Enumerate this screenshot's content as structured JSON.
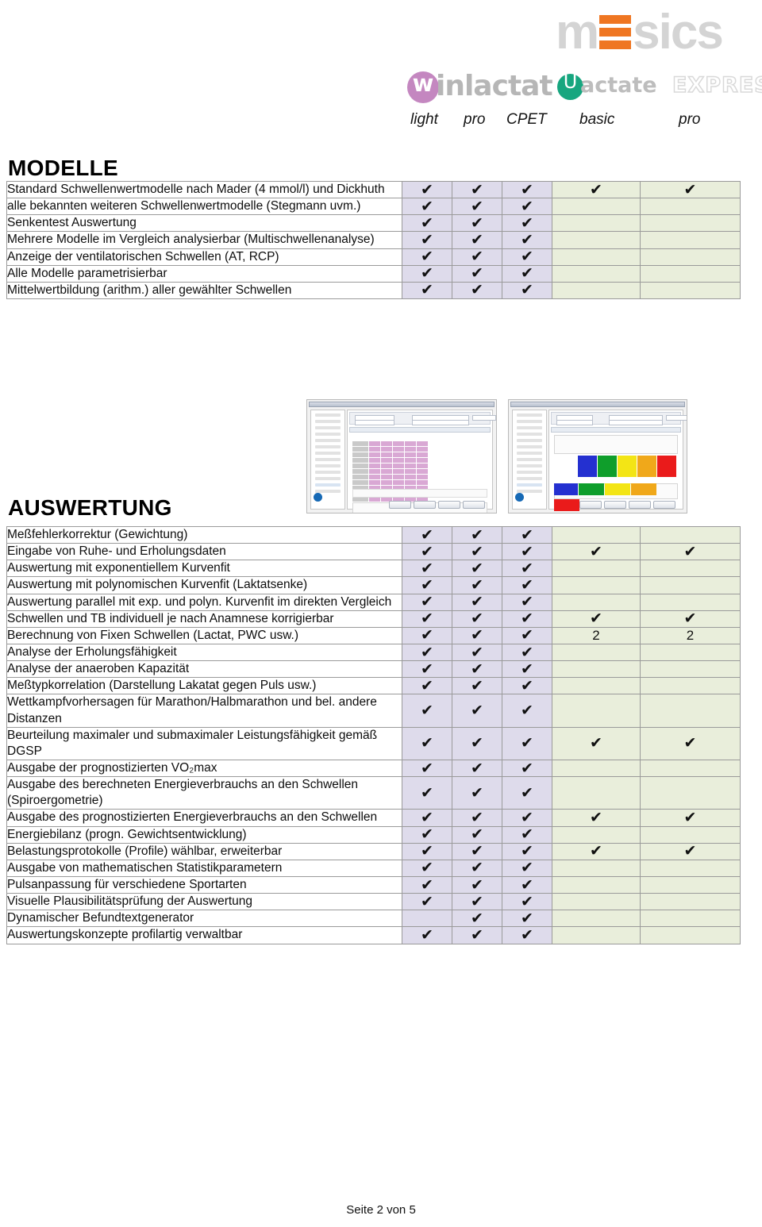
{
  "header": {
    "brand": "mesics",
    "product_winlactat": "inlactat",
    "product_winlactat_mark": "w",
    "product_lactate": "actate",
    "product_lactate_express": "EXPRESS",
    "product_lactate_mark": "U",
    "editions": [
      "light",
      "pro",
      "CPET",
      "basic",
      "pro"
    ]
  },
  "colors": {
    "brand_orange": "#ef7622",
    "brand_grey": "#d4d4d4",
    "winlactat_purple": "#c487c0",
    "lactate_green": "#17a67f",
    "col_group_a_bg": "#dedbeb",
    "col_group_b_bg": "#e9eedb"
  },
  "sections": [
    {
      "title": "MODELLE",
      "rows": [
        {
          "label": "Standard Schwellenwertmodelle nach Mader (4 mmol/l) und Dickhuth",
          "cells": [
            "✔",
            "✔",
            "✔",
            "✔",
            "✔"
          ]
        },
        {
          "label": "alle bekannten weiteren Schwellenwertmodelle (Stegmann uvm.)",
          "cells": [
            "✔",
            "✔",
            "✔",
            "",
            ""
          ]
        },
        {
          "label": "Senkentest Auswertung",
          "cells": [
            "✔",
            "✔",
            "✔",
            "",
            ""
          ]
        },
        {
          "label": "Mehrere Modelle im Vergleich analysierbar (Multischwellenanalyse)",
          "cells": [
            "✔",
            "✔",
            "✔",
            "",
            ""
          ]
        },
        {
          "label": "Anzeige der ventilatorischen Schwellen (AT, RCP)",
          "cells": [
            "✔",
            "✔",
            "✔",
            "",
            ""
          ]
        },
        {
          "label": "Alle Modelle parametrisierbar",
          "cells": [
            "✔",
            "✔",
            "✔",
            "",
            ""
          ]
        },
        {
          "label": "Mittelwertbildung (arithm.) aller gewählter Schwellen",
          "cells": [
            "✔",
            "✔",
            "✔",
            "",
            ""
          ]
        }
      ]
    },
    {
      "title": "AUSWERTUNG",
      "rows": [
        {
          "label": "Meßfehlerkorrektur (Gewichtung)",
          "cells": [
            "✔",
            "✔",
            "✔",
            "",
            ""
          ]
        },
        {
          "label": "Eingabe von Ruhe- und Erholungsdaten",
          "cells": [
            "✔",
            "✔",
            "✔",
            "✔",
            "✔"
          ]
        },
        {
          "label": "Auswertung mit exponentiellem Kurvenfit",
          "cells": [
            "✔",
            "✔",
            "✔",
            "",
            ""
          ]
        },
        {
          "label": "Auswertung mit polynomischen Kurvenfit (Laktatsenke)",
          "cells": [
            "✔",
            "✔",
            "✔",
            "",
            ""
          ]
        },
        {
          "label": "Auswertung parallel mit exp. und polyn. Kurvenfit im direkten Vergleich",
          "cells": [
            "✔",
            "✔",
            "✔",
            "",
            ""
          ]
        },
        {
          "label": "Schwellen und TB individuell je nach Anamnese korrigierbar",
          "cells": [
            "✔",
            "✔",
            "✔",
            "✔",
            "✔"
          ]
        },
        {
          "label": "Berechnung von Fixen Schwellen (Lactat, PWC usw.)",
          "cells": [
            "✔",
            "✔",
            "✔",
            "2",
            "2"
          ]
        },
        {
          "label": "Analyse der Erholungsfähigkeit",
          "cells": [
            "✔",
            "✔",
            "✔",
            "",
            ""
          ]
        },
        {
          "label": "Analyse der anaeroben Kapazität",
          "cells": [
            "✔",
            "✔",
            "✔",
            "",
            ""
          ]
        },
        {
          "label": "Meßtypkorrelation (Darstellung Lakatat gegen Puls usw.)",
          "cells": [
            "✔",
            "✔",
            "✔",
            "",
            ""
          ]
        },
        {
          "label": "Wettkampfvorhersagen für Marathon/Halbmarathon und bel. andere Distanzen",
          "cells": [
            "✔",
            "✔",
            "✔",
            "",
            ""
          ]
        },
        {
          "label": "Beurteilung maximaler und submaximaler Leistungsfähigkeit gemäß DGSP",
          "cells": [
            "✔",
            "✔",
            "✔",
            "✔",
            "✔"
          ]
        },
        {
          "label": "Ausgabe der prognostizierten VO₂max",
          "cells": [
            "✔",
            "✔",
            "✔",
            "",
            ""
          ]
        },
        {
          "label": "Ausgabe des berechneten Energieverbrauchs an den Schwellen (Spiroergometrie)",
          "cells": [
            "✔",
            "✔",
            "✔",
            "",
            ""
          ]
        },
        {
          "label": "Ausgabe des prognostizierten Energieverbrauchs an den Schwellen",
          "cells": [
            "✔",
            "✔",
            "✔",
            "✔",
            "✔"
          ]
        },
        {
          "label": "Energiebilanz (progn. Gewichtsentwicklung)",
          "cells": [
            "✔",
            "✔",
            "✔",
            "",
            ""
          ]
        },
        {
          "label": "Belastungsprotokolle (Profile) wählbar, erweiterbar",
          "cells": [
            "✔",
            "✔",
            "✔",
            "✔",
            "✔"
          ]
        },
        {
          "label": "Ausgabe von mathematischen Statistikparametern",
          "cells": [
            "✔",
            "✔",
            "✔",
            "",
            ""
          ]
        },
        {
          "label": "Pulsanpassung für verschiedene Sportarten",
          "cells": [
            "✔",
            "✔",
            "✔",
            "",
            ""
          ]
        },
        {
          "label": "Visuelle Plausibilitätsprüfung der Auswertung",
          "cells": [
            "✔",
            "✔",
            "✔",
            "",
            ""
          ]
        },
        {
          "label": "Dynamischer Befundtextgenerator",
          "cells": [
            "",
            "✔",
            "✔",
            "",
            ""
          ]
        },
        {
          "label": "Auswertungskonzepte profilartig verwaltbar",
          "cells": [
            "✔",
            "✔",
            "✔",
            "",
            ""
          ]
        }
      ]
    }
  ],
  "screenshots": [
    {
      "name": "winlactat-threshold-table-screenshot"
    },
    {
      "name": "winlactat-training-zones-screenshot"
    }
  ],
  "footer": {
    "page": "Seite 2 von 5"
  }
}
